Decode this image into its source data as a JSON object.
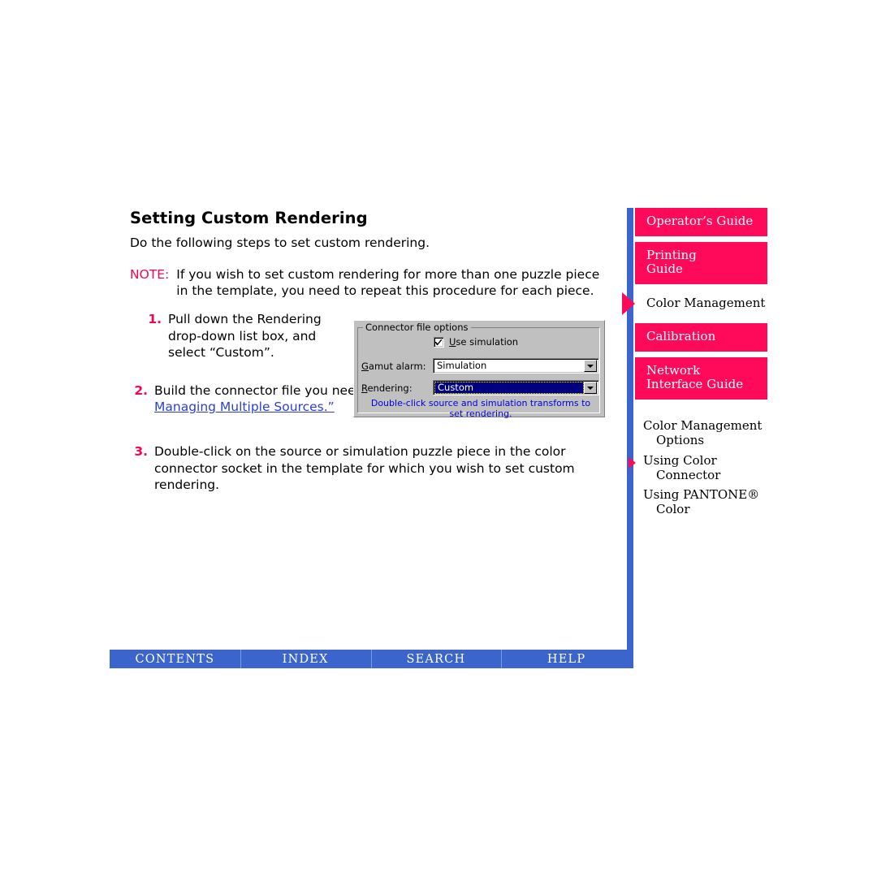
{
  "document": {
    "title": "Setting Custom Rendering",
    "intro": "Do the following steps to set custom rendering.",
    "note": {
      "label": "NOTE:",
      "text": "If you wish to set custom rendering for more than one puzzle piece in the template, you need to repeat this procedure for each piece."
    },
    "steps": [
      {
        "number": "1.",
        "text": "Pull down the Rendering drop-down list box, and select “Custom”."
      },
      {
        "number": "2.",
        "text_before": "Build the connector file you need for your job. ",
        "link_text": "Refer to “Color Managing Multiple Sources.”"
      },
      {
        "number": "3.",
        "text": "Double-click on the source or simulation puzzle piece in the color connector socket in the template for which you wish to set custom rendering."
      }
    ]
  },
  "dialog": {
    "groupbox_title": "Connector file options",
    "use_simulation": {
      "label": "Use simulation",
      "checked": true
    },
    "gamut_alarm": {
      "label": "Gamut alarm:",
      "value": "Simulation"
    },
    "rendering": {
      "label": "Rendering:",
      "value": "Custom",
      "focused": true
    },
    "hint": "Double-click source and simulation transforms to set rendering."
  },
  "bottom_bar": {
    "items": [
      {
        "label": "CONTENTS"
      },
      {
        "label": "INDEX"
      },
      {
        "label": "SEARCH"
      },
      {
        "label": "HELP"
      }
    ]
  },
  "sidebar": {
    "tabs": [
      {
        "label": "Operator’s Guide",
        "current": false
      },
      {
        "label": "Printing Guide",
        "line1": "Printing",
        "line2": "Guide",
        "current": false
      },
      {
        "label": "Color Management",
        "current": true
      },
      {
        "label": "Calibration",
        "current": false
      },
      {
        "label": "Network Interface Guide",
        "line1": "Network",
        "line2": "Interface Guide",
        "current": false
      }
    ],
    "subtopics": [
      {
        "line1": "Color Management",
        "line2": "Options",
        "current": false
      },
      {
        "line1": "Using Color",
        "line2": "Connector",
        "current": true
      },
      {
        "line1": "Using PANTONE®",
        "line2": "Color",
        "current": false
      }
    ]
  },
  "colors": {
    "accent_pink": "#FF0A5A",
    "note_red": "#F5054F",
    "nav_blue": "#3B64CC",
    "link_blue": "#2B3FD8",
    "dialog_face": "#C0C0C0",
    "combo_selected": "#000080",
    "hint_blue": "#0000E0"
  }
}
